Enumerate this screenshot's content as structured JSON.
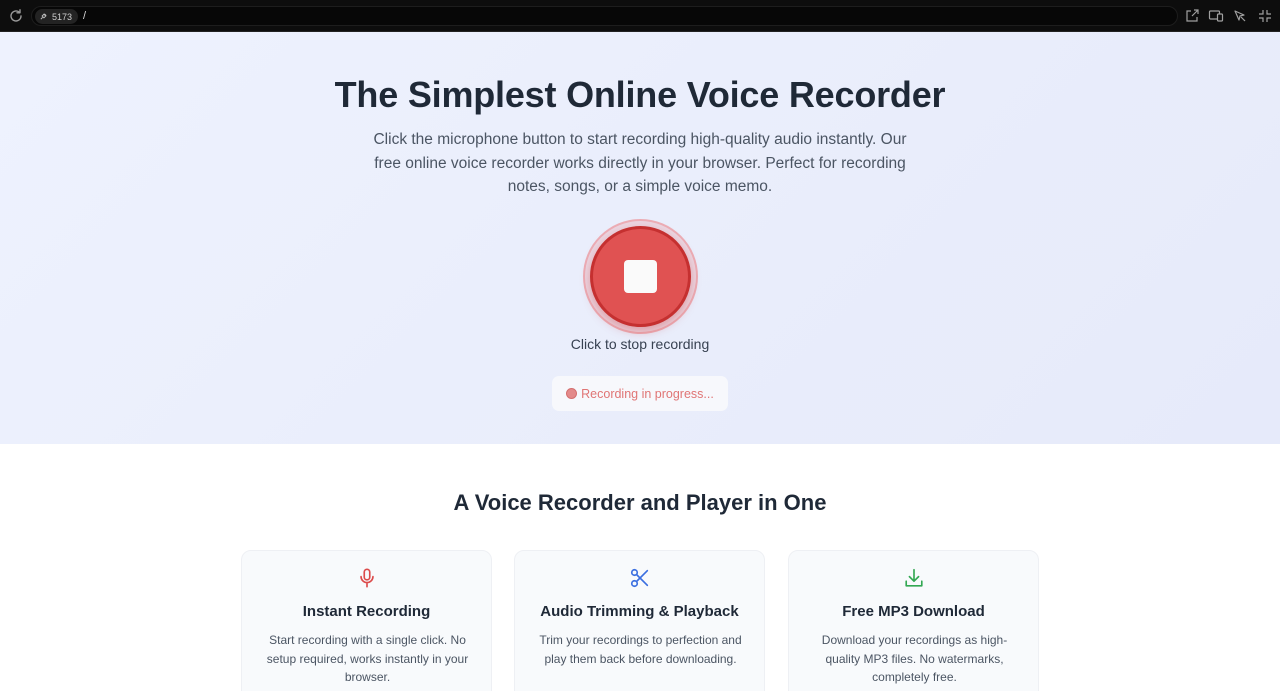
{
  "browser": {
    "port": "5173",
    "path": "/"
  },
  "hero": {
    "title": "The Simplest Online Voice Recorder",
    "description": "Click the microphone button to start recording high-quality audio instantly. Our free online voice recorder works directly in your browser. Perfect for recording notes, songs, or a simple voice memo.",
    "record_button_icon": "stop-icon",
    "caption": "Click to stop recording",
    "status": "Recording in progress..."
  },
  "features": {
    "title": "A Voice Recorder and Player in One",
    "cards": [
      {
        "icon": "microphone-icon",
        "icon_color": "#dc4b4b",
        "title": "Instant Recording",
        "text": "Start recording with a single click. No setup required, works instantly in your browser."
      },
      {
        "icon": "scissors-icon",
        "icon_color": "#3b6fe0",
        "title": "Audio Trimming & Playback",
        "text": "Trim your recordings to perfection and play them back before downloading."
      },
      {
        "icon": "download-icon",
        "icon_color": "#33a853",
        "title": "Free MP3 Download",
        "text": "Download your recordings as high-quality MP3 files. No watermarks, completely free."
      }
    ]
  }
}
